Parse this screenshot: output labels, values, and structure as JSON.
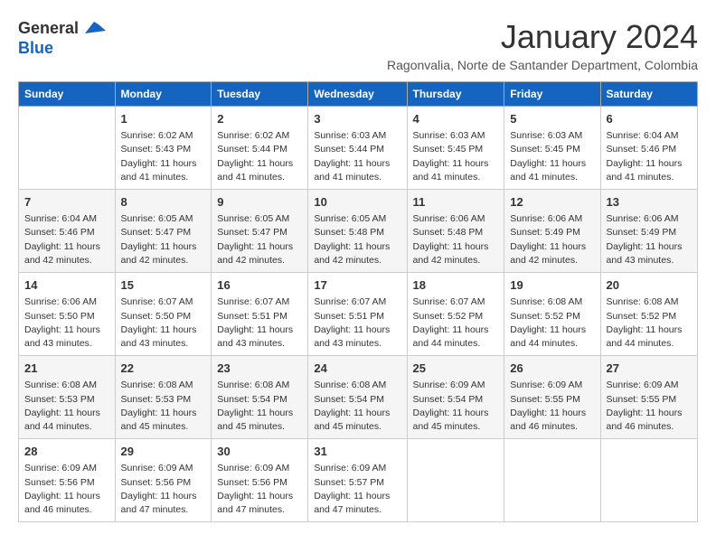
{
  "header": {
    "logo_line1": "General",
    "logo_line2": "Blue",
    "month_title": "January 2024",
    "location": "Ragonvalia, Norte de Santander Department, Colombia"
  },
  "weekdays": [
    "Sunday",
    "Monday",
    "Tuesday",
    "Wednesday",
    "Thursday",
    "Friday",
    "Saturday"
  ],
  "weeks": [
    [
      {
        "day": "",
        "info": ""
      },
      {
        "day": "1",
        "info": "Sunrise: 6:02 AM\nSunset: 5:43 PM\nDaylight: 11 hours and 41 minutes."
      },
      {
        "day": "2",
        "info": "Sunrise: 6:02 AM\nSunset: 5:44 PM\nDaylight: 11 hours and 41 minutes."
      },
      {
        "day": "3",
        "info": "Sunrise: 6:03 AM\nSunset: 5:44 PM\nDaylight: 11 hours and 41 minutes."
      },
      {
        "day": "4",
        "info": "Sunrise: 6:03 AM\nSunset: 5:45 PM\nDaylight: 11 hours and 41 minutes."
      },
      {
        "day": "5",
        "info": "Sunrise: 6:03 AM\nSunset: 5:45 PM\nDaylight: 11 hours and 41 minutes."
      },
      {
        "day": "6",
        "info": "Sunrise: 6:04 AM\nSunset: 5:46 PM\nDaylight: 11 hours and 41 minutes."
      }
    ],
    [
      {
        "day": "7",
        "info": "Sunrise: 6:04 AM\nSunset: 5:46 PM\nDaylight: 11 hours and 42 minutes."
      },
      {
        "day": "8",
        "info": "Sunrise: 6:05 AM\nSunset: 5:47 PM\nDaylight: 11 hours and 42 minutes."
      },
      {
        "day": "9",
        "info": "Sunrise: 6:05 AM\nSunset: 5:47 PM\nDaylight: 11 hours and 42 minutes."
      },
      {
        "day": "10",
        "info": "Sunrise: 6:05 AM\nSunset: 5:48 PM\nDaylight: 11 hours and 42 minutes."
      },
      {
        "day": "11",
        "info": "Sunrise: 6:06 AM\nSunset: 5:48 PM\nDaylight: 11 hours and 42 minutes."
      },
      {
        "day": "12",
        "info": "Sunrise: 6:06 AM\nSunset: 5:49 PM\nDaylight: 11 hours and 42 minutes."
      },
      {
        "day": "13",
        "info": "Sunrise: 6:06 AM\nSunset: 5:49 PM\nDaylight: 11 hours and 43 minutes."
      }
    ],
    [
      {
        "day": "14",
        "info": "Sunrise: 6:06 AM\nSunset: 5:50 PM\nDaylight: 11 hours and 43 minutes."
      },
      {
        "day": "15",
        "info": "Sunrise: 6:07 AM\nSunset: 5:50 PM\nDaylight: 11 hours and 43 minutes."
      },
      {
        "day": "16",
        "info": "Sunrise: 6:07 AM\nSunset: 5:51 PM\nDaylight: 11 hours and 43 minutes."
      },
      {
        "day": "17",
        "info": "Sunrise: 6:07 AM\nSunset: 5:51 PM\nDaylight: 11 hours and 43 minutes."
      },
      {
        "day": "18",
        "info": "Sunrise: 6:07 AM\nSunset: 5:52 PM\nDaylight: 11 hours and 44 minutes."
      },
      {
        "day": "19",
        "info": "Sunrise: 6:08 AM\nSunset: 5:52 PM\nDaylight: 11 hours and 44 minutes."
      },
      {
        "day": "20",
        "info": "Sunrise: 6:08 AM\nSunset: 5:52 PM\nDaylight: 11 hours and 44 minutes."
      }
    ],
    [
      {
        "day": "21",
        "info": "Sunrise: 6:08 AM\nSunset: 5:53 PM\nDaylight: 11 hours and 44 minutes."
      },
      {
        "day": "22",
        "info": "Sunrise: 6:08 AM\nSunset: 5:53 PM\nDaylight: 11 hours and 45 minutes."
      },
      {
        "day": "23",
        "info": "Sunrise: 6:08 AM\nSunset: 5:54 PM\nDaylight: 11 hours and 45 minutes."
      },
      {
        "day": "24",
        "info": "Sunrise: 6:08 AM\nSunset: 5:54 PM\nDaylight: 11 hours and 45 minutes."
      },
      {
        "day": "25",
        "info": "Sunrise: 6:09 AM\nSunset: 5:54 PM\nDaylight: 11 hours and 45 minutes."
      },
      {
        "day": "26",
        "info": "Sunrise: 6:09 AM\nSunset: 5:55 PM\nDaylight: 11 hours and 46 minutes."
      },
      {
        "day": "27",
        "info": "Sunrise: 6:09 AM\nSunset: 5:55 PM\nDaylight: 11 hours and 46 minutes."
      }
    ],
    [
      {
        "day": "28",
        "info": "Sunrise: 6:09 AM\nSunset: 5:56 PM\nDaylight: 11 hours and 46 minutes."
      },
      {
        "day": "29",
        "info": "Sunrise: 6:09 AM\nSunset: 5:56 PM\nDaylight: 11 hours and 47 minutes."
      },
      {
        "day": "30",
        "info": "Sunrise: 6:09 AM\nSunset: 5:56 PM\nDaylight: 11 hours and 47 minutes."
      },
      {
        "day": "31",
        "info": "Sunrise: 6:09 AM\nSunset: 5:57 PM\nDaylight: 11 hours and 47 minutes."
      },
      {
        "day": "",
        "info": ""
      },
      {
        "day": "",
        "info": ""
      },
      {
        "day": "",
        "info": ""
      }
    ]
  ]
}
